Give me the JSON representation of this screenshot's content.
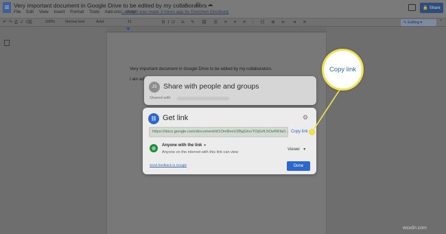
{
  "doc": {
    "title": "Very important document in Google Drive to be edited by my collaborators",
    "title_icons": "☆ ⊡ ☁",
    "menu": [
      "File",
      "Edit",
      "View",
      "Insert",
      "Format",
      "Tools",
      "Add-ons",
      "Help"
    ],
    "last_edit": "Last edit was made 3 hours ago by Gretchen Grunburg",
    "share_button": "Share",
    "line1": "Very important document in Google Drive to be edited by my collaborators.",
    "line2": "I am adi"
  },
  "toolbar": {
    "zoom": "100%",
    "style": "Normal text",
    "font": "Arial",
    "font_size": "11",
    "editing": "Editing",
    "editing_caret": "▾",
    "collapse": "⌃"
  },
  "share_panel": {
    "avatar_initials": "JS",
    "title": "Share with people and groups",
    "shared_with": "Shared with"
  },
  "link_panel": {
    "icon": "link-icon",
    "title": "Get link",
    "url": "https://docs.google.com/document/d/1Om8veU2BgGtvvTOjGrfL5OeRKfa0...",
    "copy_link": "Copy link",
    "access": "Anyone with the link",
    "access_caret": "▾",
    "access_desc": "Anyone on the internet with this link can view",
    "role": "Viewer",
    "role_caret": "▾",
    "feedback": "Send feedback to Google",
    "done": "Done"
  },
  "callout": {
    "text": "Copy link",
    "colors": {
      "ring": "#f2e24f",
      "text": "#2c66b8"
    }
  },
  "watermark": "wsxdn.com",
  "colors": {
    "overlay": "#6e6e6e",
    "accent_blue": "#2f66c9",
    "url_green": "#2b7a3c",
    "globe_green": "#1f8a3a"
  }
}
